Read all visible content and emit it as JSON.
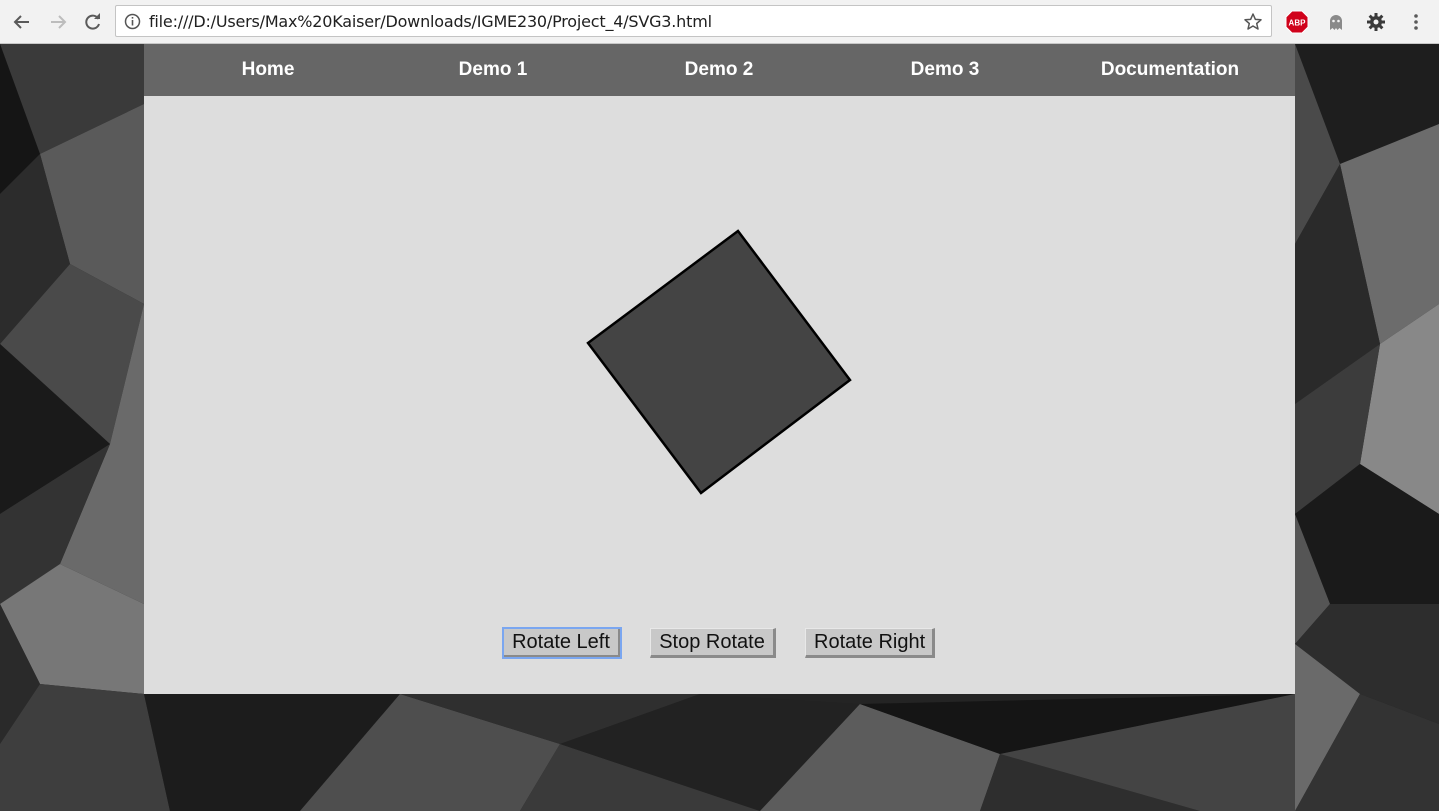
{
  "browser": {
    "url": "file:///D:/Users/Max%20Kaiser/Downloads/IGME230/Project_4/SVG3.html",
    "extensions": [
      "abp-icon",
      "ghostery-icon",
      "settings-gear-icon"
    ],
    "abp_label": "ABP"
  },
  "nav": {
    "items": [
      {
        "label": "Home"
      },
      {
        "label": "Demo 1"
      },
      {
        "label": "Demo 2"
      },
      {
        "label": "Demo 3"
      },
      {
        "label": "Documentation"
      }
    ]
  },
  "demo": {
    "square_fill": "#444444",
    "square_stroke": "#000000",
    "content_bg": "#dddddd",
    "navbar_bg": "#666666"
  },
  "controls": {
    "rotate_left": "Rotate Left",
    "stop_rotate": "Stop Rotate",
    "rotate_right": "Rotate Right"
  }
}
